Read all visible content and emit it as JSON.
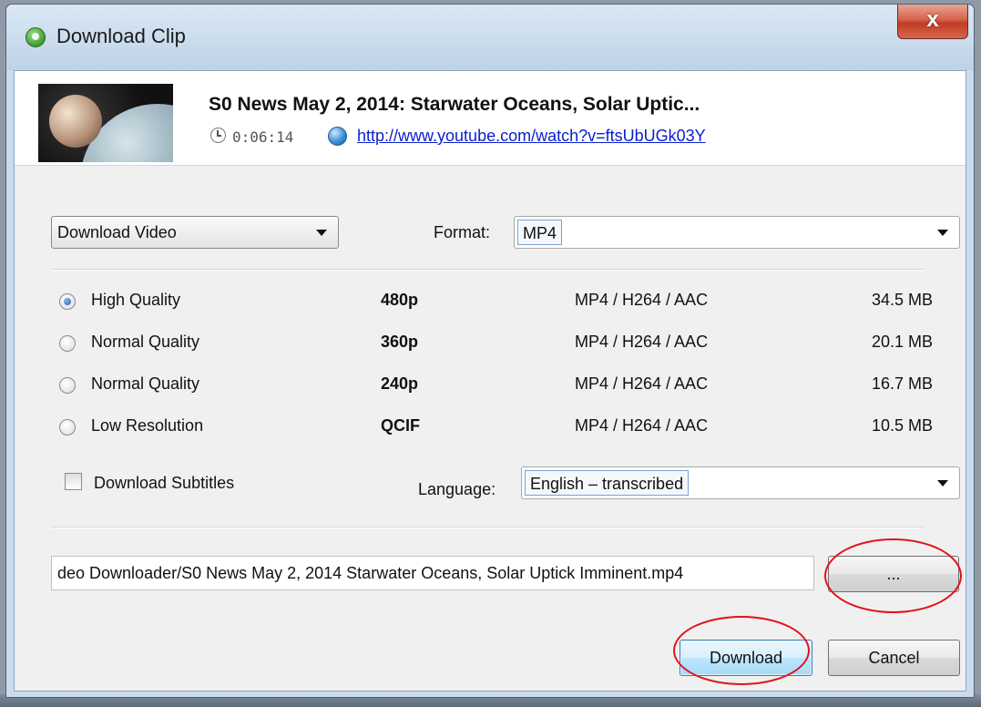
{
  "window": {
    "title": "Download Clip",
    "close_label": "x"
  },
  "video": {
    "title": "S0 News May 2, 2014: Starwater Oceans, Solar Uptic...",
    "duration": "0:06:14",
    "url": "http://www.youtube.com/watch?v=ftsUbUGk03Y"
  },
  "mode_select": {
    "value": "Download Video"
  },
  "format": {
    "label": "Format:",
    "value": "MP4"
  },
  "qualities": [
    {
      "name": "High Quality",
      "resolution": "480p",
      "codec": "MP4 / H264 / AAC",
      "size": "34.5 MB",
      "selected": true
    },
    {
      "name": "Normal Quality",
      "resolution": "360p",
      "codec": "MP4 / H264 / AAC",
      "size": "20.1 MB",
      "selected": false
    },
    {
      "name": "Normal Quality",
      "resolution": "240p",
      "codec": "MP4 / H264 / AAC",
      "size": "16.7 MB",
      "selected": false
    },
    {
      "name": "Low Resolution",
      "resolution": "QCIF",
      "codec": "MP4 / H264 / AAC",
      "size": "10.5 MB",
      "selected": false
    }
  ],
  "subtitles": {
    "checkbox_label": "Download Subtitles",
    "checked": false,
    "language_label": "Language:",
    "language_value": "English – transcribed"
  },
  "save_path": {
    "value": "deo Downloader/S0 News May 2, 2014  Starwater Oceans, Solar Uptick Imminent.mp4",
    "browse_label": "..."
  },
  "buttons": {
    "download": "Download",
    "cancel": "Cancel"
  },
  "icons": {
    "app": "app-download-icon",
    "clock": "clock-icon",
    "globe": "globe-icon",
    "dropdown": "chevron-down-icon"
  },
  "colors": {
    "annotation": "#e0121b",
    "link": "#0b1fcc",
    "close_button": "#c23c23"
  }
}
